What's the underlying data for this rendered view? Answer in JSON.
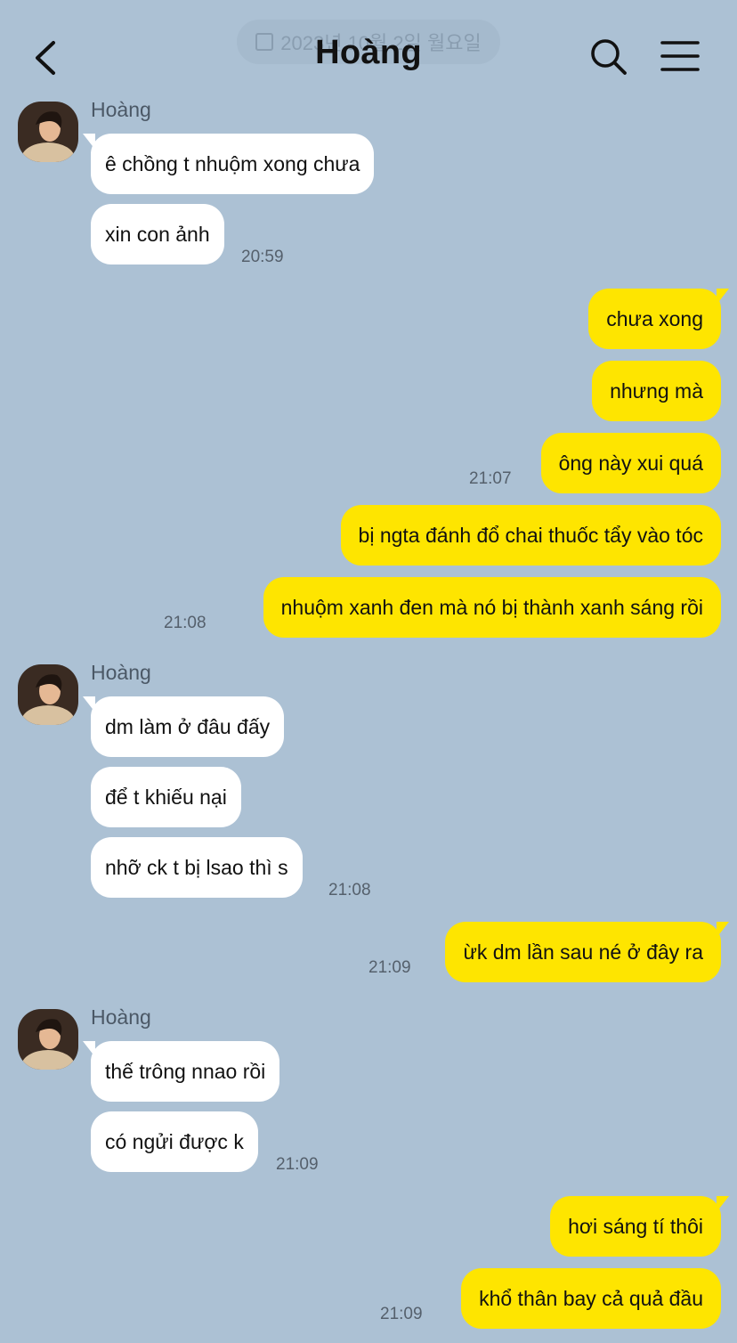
{
  "header": {
    "title": "Hoàng",
    "date_pill": "2023년 10월 2일 월요일"
  },
  "colors": {
    "background": "#acc1d4",
    "incoming_bubble": "#ffffff",
    "outgoing_bubble": "#fee500"
  },
  "icons": {
    "back": "chevron-left-icon",
    "search": "search-icon",
    "menu": "hamburger-menu-icon"
  },
  "messages": {
    "g1": {
      "sender": "Hoàng",
      "m1": "ê chồng t nhuộm xong chưa",
      "m2": "xin con ảnh",
      "time": "20:59"
    },
    "o1": {
      "m1": "chưa xong",
      "m2": "nhưng mà",
      "m3": "ông này xui quá",
      "time1": "21:07",
      "m4": "bị ngta đánh đổ chai thuốc tẩy vào tóc",
      "m5": "nhuộm xanh đen mà nó bị thành xanh sáng rồi",
      "time2": "21:08"
    },
    "g2": {
      "sender": "Hoàng",
      "m1": "dm làm ở đâu đấy",
      "m2": "để t khiếu nại",
      "m3": "nhỡ ck t bị lsao thì s",
      "time": "21:08"
    },
    "o2": {
      "m1": "ừk dm lần sau né ở đây ra",
      "time": "21:09"
    },
    "g3": {
      "sender": "Hoàng",
      "m1": "thế trông nnao rồi",
      "m2": "có ngửi được k",
      "time": "21:09"
    },
    "o3": {
      "m1": "hơi sáng tí thôi",
      "m2": "khổ thân bay cả quả đầu",
      "time": "21:09"
    }
  }
}
